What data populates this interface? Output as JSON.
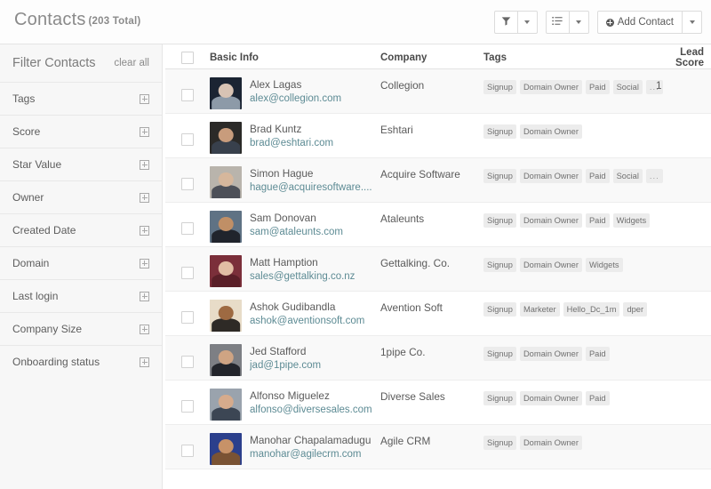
{
  "header": {
    "title": "Contacts",
    "count_label": "(203 Total)",
    "toolbar": {
      "filter_icon": "funnel-icon",
      "filter_caret": "chevron-down-icon",
      "list_icon": "list-view-icon",
      "list_caret": "chevron-down-icon",
      "add_contact_label": "Add Contact",
      "add_contact_icon": "plus-circle-icon",
      "add_caret": "chevron-down-icon"
    }
  },
  "sidebar": {
    "title": "Filter Contacts",
    "clear_all": "clear all",
    "items": [
      {
        "label": "Tags",
        "icon": "plus-box-icon"
      },
      {
        "label": "Score",
        "icon": "plus-box-icon"
      },
      {
        "label": "Star Value",
        "icon": "plus-box-icon"
      },
      {
        "label": "Owner",
        "icon": "plus-box-icon"
      },
      {
        "label": "Created Date",
        "icon": "plus-box-icon"
      },
      {
        "label": "Domain",
        "icon": "plus-box-icon"
      },
      {
        "label": "Last login",
        "icon": "plus-box-icon"
      },
      {
        "label": "Company Size",
        "icon": "plus-box-icon"
      },
      {
        "label": "Onboarding status",
        "icon": "plus-box-icon"
      }
    ]
  },
  "table": {
    "columns": [
      "Basic Info",
      "Company",
      "Tags",
      "Lead Score"
    ],
    "rows": [
      {
        "name": "Alex Lagas",
        "email": "alex@collegion.com",
        "company": "Collegion",
        "tags": [
          "Signup",
          "Domain Owner",
          "Paid",
          "Social",
          "..."
        ],
        "lead_score": "1",
        "avatar": {
          "bg": "#1b2433",
          "skin": "#d8c3b4",
          "cloth": "#8d9aa8"
        }
      },
      {
        "name": "Brad Kuntz",
        "email": "brad@eshtari.com",
        "company": "Eshtari",
        "tags": [
          "Signup",
          "Domain Owner"
        ],
        "lead_score": "",
        "avatar": {
          "bg": "#2b2a28",
          "skin": "#c89c7c",
          "cloth": "#38404c"
        }
      },
      {
        "name": "Simon Hague",
        "email": "hague@acquiresoftware....",
        "company": "Acquire Software",
        "tags": [
          "Signup",
          "Domain Owner",
          "Paid",
          "Social",
          "..."
        ],
        "lead_score": "",
        "avatar": {
          "bg": "#b9b4ac",
          "skin": "#d6b79c",
          "cloth": "#4d5058"
        }
      },
      {
        "name": "Sam Donovan",
        "email": "sam@ataleunts.com",
        "company": "Ataleunts",
        "tags": [
          "Signup",
          "Domain Owner",
          "Paid",
          "Widgets"
        ],
        "lead_score": "",
        "avatar": {
          "bg": "#5f7284",
          "skin": "#c08f66",
          "cloth": "#20242c"
        }
      },
      {
        "name": "Matt Hamption",
        "email": "sales@gettalking.co.nz",
        "company": "Gettalking. Co.",
        "tags": [
          "Signup",
          "Domain Owner",
          "Widgets"
        ],
        "lead_score": "",
        "avatar": {
          "bg": "#7b2f3a",
          "skin": "#e2bda4",
          "cloth": "#5a1f28"
        }
      },
      {
        "name": "Ashok Gudibandla",
        "email": "ashok@aventionsoft.com",
        "company": "Avention Soft",
        "tags": [
          "Signup",
          "Marketer",
          "Hello_Dc_1m",
          "dper"
        ],
        "lead_score": "",
        "avatar": {
          "bg": "#e8dcc8",
          "skin": "#9e6a42",
          "cloth": "#2e2a26"
        }
      },
      {
        "name": "Jed Stafford",
        "email": "jad@1pipe.com",
        "company": "1pipe Co.",
        "tags": [
          "Signup",
          "Domain Owner",
          "Paid"
        ],
        "lead_score": "",
        "avatar": {
          "bg": "#7d7f84",
          "skin": "#cfa483",
          "cloth": "#23252b"
        }
      },
      {
        "name": "Alfonso Miguelez",
        "email": "alfonso@diversesales.com",
        "company": "Diverse Sales",
        "tags": [
          "Signup",
          "Domain Owner",
          "Paid"
        ],
        "lead_score": "",
        "avatar": {
          "bg": "#9aa3ad",
          "skin": "#d6ab8c",
          "cloth": "#3c4654"
        }
      },
      {
        "name": "Manohar Chapalamadugu",
        "email": "manohar@agilecrm.com",
        "company": "Agile CRM",
        "tags": [
          "Signup",
          "Domain Owner"
        ],
        "lead_score": "",
        "avatar": {
          "bg": "#2b3f8c",
          "skin": "#c79268",
          "cloth": "#7a5334"
        }
      }
    ]
  }
}
